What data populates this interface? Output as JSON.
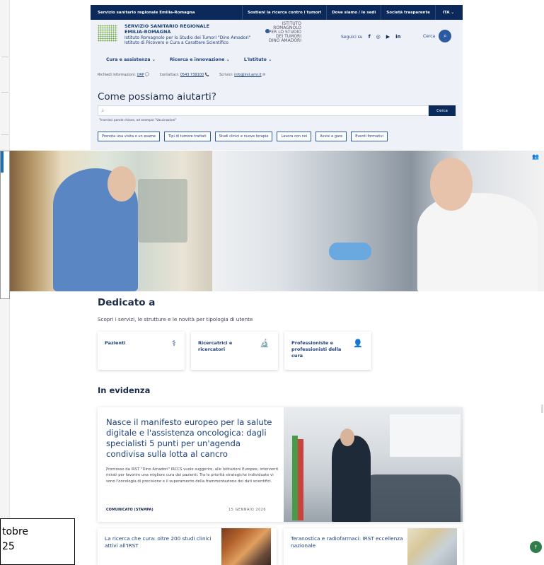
{
  "topbar": {
    "region": "Servizio sanitario regionale Emilia-Romagna",
    "links": [
      "Sostieni la ricerca contro i tumori",
      "Dove siamo / le sedi",
      "Società trasparente"
    ],
    "lang": "ITA ⌄"
  },
  "header": {
    "logo_line1": "SERVIZIO SANITARIO REGIONALE",
    "logo_line2": "EMILIA-ROMAGNA",
    "logo_line3": "Istituto Romagnolo per lo Studio dei Tumori \"Dino Amadori\"",
    "logo_line4": "Istituto di Ricovero e Cura a Carattere Scientifico",
    "irst_lines": [
      "ISTITUTO",
      "ROMAGNOLO",
      "PER LO STUDIO",
      "DEI TUMORI",
      "DINO AMADORI"
    ],
    "follow": "Seguici su",
    "search_label": "Cerca",
    "nav": [
      "Cura e assistenza ⌄",
      "Ricerca e innovazione ⌄",
      "L'Istituto ⌄"
    ],
    "info_label1": "Richiedi informazioni:",
    "info_link1": "URP",
    "info_label2": "Contattaci:",
    "info_link2": "0543 739100",
    "info_label3": "Scrivici:",
    "info_link3": "info@irst.emr.it"
  },
  "help": {
    "title": "Come possiamo aiutarti?",
    "placeholder": "",
    "hint": "\"Inserisci parole chiave, ad esempio \"Vaccinazioni\"",
    "search_button": "Cerca",
    "chips": [
      "Prenota una visita o un esame",
      "Tipi di tumore trattati",
      "Studi clinici e nuove terapie",
      "Lavora con noi",
      "Avvisi e gare",
      "Eventi formativi"
    ]
  },
  "dedicato": {
    "title": "Dedicato a",
    "subtitle": "Scopri i servizi, le strutture e le novità per tipologia di utente",
    "cards": [
      {
        "label": "Pazienti",
        "icon": "patient-icon"
      },
      {
        "label": "Ricercatrici e ricercatori",
        "icon": "microscope-icon"
      },
      {
        "label": "Professioniste e professionisti della cura",
        "icon": "doctor-icon"
      }
    ]
  },
  "evidenza": {
    "title": "In evidenza",
    "feature_title": "Nasce il manifesto europeo per la salute digitale e l'assistenza oncologica: dagli specialisti 5 punti per un'agenda condivisa sulla lotta al cancro",
    "feature_body": "Promosso da IRST \"Dino Amadori\" IRCCS vuole suggerire, alle Istituzioni Europee, interventi mirati per favorire una migliore cura dei pazienti. Tra le priorità strategiche individuate vi sono l'oncologia di precisione e il superamento della frammentazione dei dati scientifici.",
    "feature_category": "COMUNICATO (STAMPA)",
    "feature_date": "15 GENNAIO 2026",
    "small1": "La ricerca che cura: oltre 200 studi clinici attivi all'IRST",
    "small2": "Teranostica e radiofarmaci: IRST eccellenza nazionale"
  },
  "overlay": {
    "line1": "tobre",
    "line2": "25"
  },
  "colors": {
    "navy": "#0b2a5b",
    "brand_blue": "#1c3f7a",
    "header_bg": "#eef2f8",
    "green": "#2e7d4a"
  }
}
